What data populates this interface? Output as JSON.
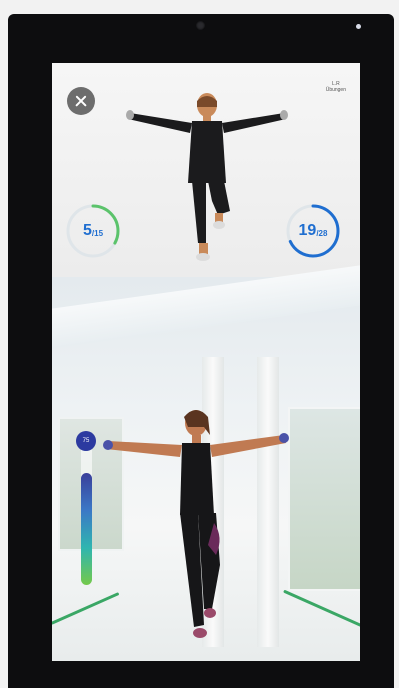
{
  "header": {
    "exercise_line1": "L.R",
    "exercise_line2": "Übungen"
  },
  "progress_left": {
    "current": "5",
    "total": "/15",
    "fraction": 0.33
  },
  "progress_right": {
    "current": "19",
    "total": "/28",
    "fraction": 0.68
  },
  "level_bar": {
    "label": "75",
    "fraction": 0.75
  },
  "colors": {
    "ring_green": "#5bc36b",
    "ring_blue": "#1f6ed0",
    "ring_track": "#dfe5e9"
  }
}
